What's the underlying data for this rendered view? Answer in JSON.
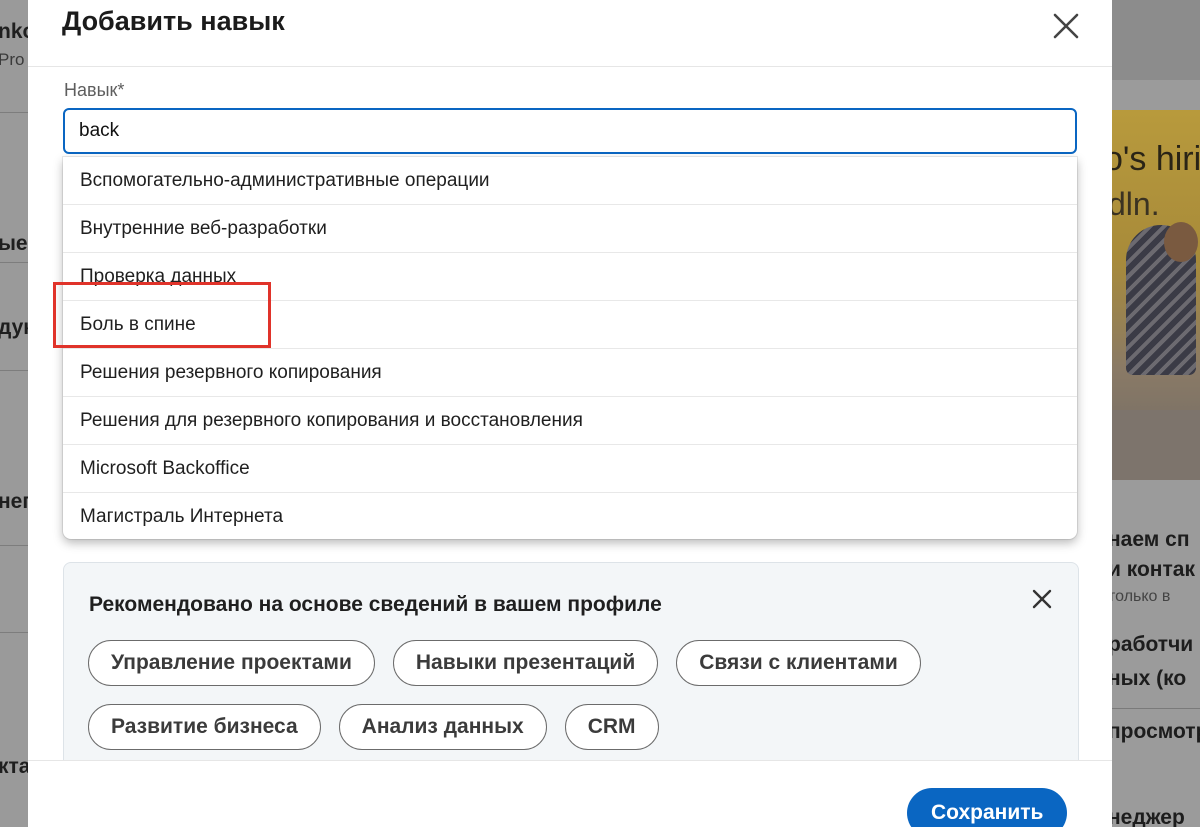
{
  "modal": {
    "title": "Добавить навык",
    "field_label": "Навык*",
    "input_value": "back",
    "suggestions": [
      "Вспомогательно-административные операции",
      "Внутренние веб-разработки",
      "Проверка данных",
      "Боль в спине",
      "Решения резервного копирования",
      "Решения для резервного копирования и восстановления",
      "Microsoft Backoffice",
      "Магистраль Интернета"
    ],
    "recommended": {
      "title": "Рекомендовано на основе сведений в вашем профиле",
      "chips_row1": [
        "Управление проектами",
        "Навыки презентаций",
        "Связи с клиентами"
      ],
      "chips_row2": [
        "Развитие бизнеса",
        "Анализ данных",
        "CRM"
      ]
    },
    "save_label": "Сохранить"
  },
  "background": {
    "left": [
      "nko",
      "Pro",
      "ые",
      "дук",
      "нег",
      "кта"
    ],
    "right": {
      "ad_line1": "o's hirin",
      "ad_line2": "dln.",
      "lines": [
        "наем сп",
        "и контак",
        "только в",
        "работчи",
        "ных (ко",
        "просмотр",
        "неджер"
      ]
    }
  },
  "colors": {
    "accent": "#0a66c2",
    "highlight_box": "#e0332a"
  }
}
